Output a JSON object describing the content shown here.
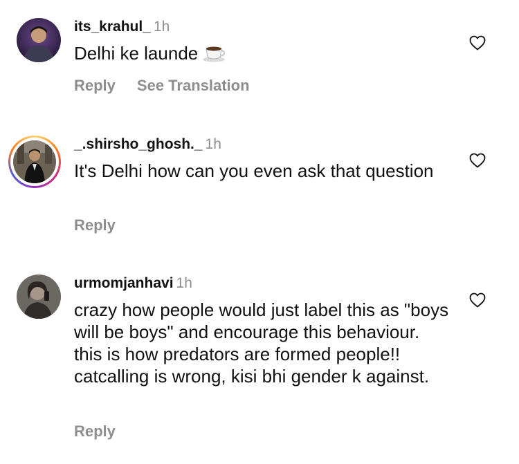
{
  "comments": [
    {
      "username": "its_krahul_",
      "time": "1h",
      "text": "Delhi ke launde",
      "emoji": "coffee-cup",
      "reply_label": "Reply",
      "translate_label": "See Translation",
      "has_story_ring": false
    },
    {
      "username": "_.shirsho_ghosh._",
      "time": "1h",
      "text": "It's Delhi how can you even ask that question",
      "reply_label": "Reply",
      "has_story_ring": true
    },
    {
      "username": "urmomjanhavi",
      "time": "1h",
      "text": "crazy how people would just label this as \"boys will be boys\" and encourage this behaviour. this is how predators are formed people!! catcalling is wrong, kisi bhi gender k against.",
      "reply_label": "Reply",
      "has_story_ring": false
    }
  ],
  "icons": {
    "like": "heart-outline-icon"
  },
  "colors": {
    "text": "#111111",
    "muted": "#8e8e8e",
    "story_ring": [
      "#feda75",
      "#fa7e1e",
      "#d62976",
      "#962fbf",
      "#4f5bd5"
    ]
  }
}
